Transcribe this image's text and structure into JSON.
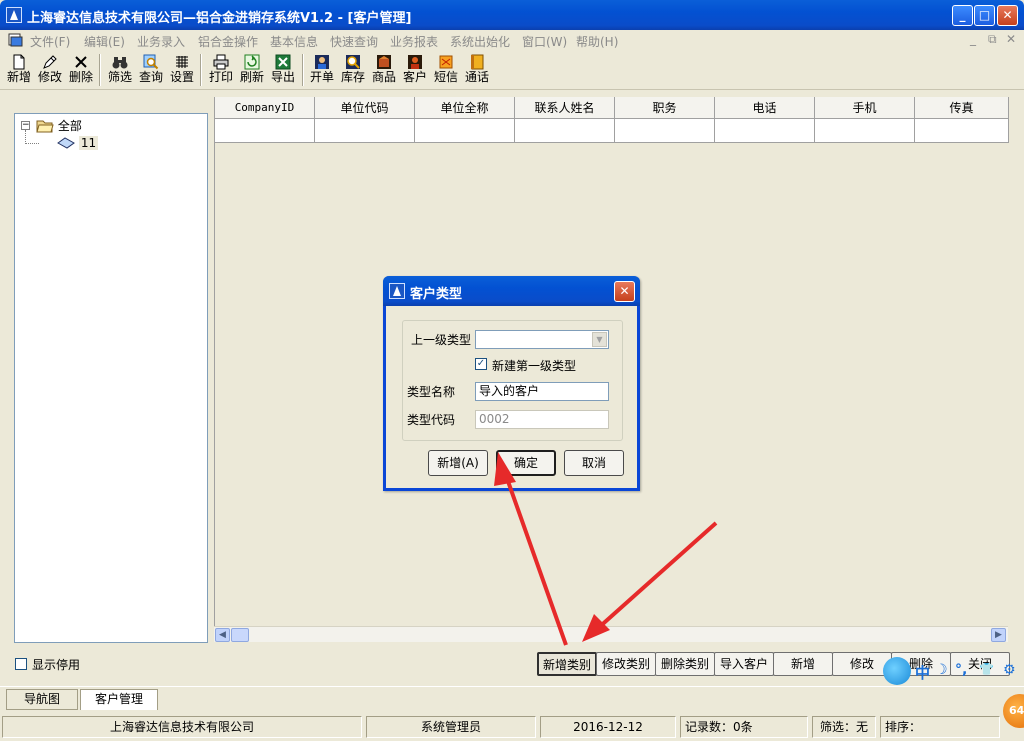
{
  "window": {
    "title": "上海睿达信息技术有限公司—铝合金进销存系统V1.2 - [客户管理]",
    "minimize": "_",
    "maximize": "□",
    "close": "✕"
  },
  "menu": {
    "items": [
      "文件(F)",
      "编辑(E)",
      "业务录入",
      "铝合金操作",
      "基本信息",
      "快速查询",
      "业务报表",
      "系统出始化",
      "窗口(W)",
      "帮助(H)"
    ],
    "mdi_minimize": "_",
    "mdi_restore": "⧉",
    "mdi_close": "✕"
  },
  "toolbar": {
    "items": [
      {
        "label": "新增",
        "icon": "new-doc-icon"
      },
      {
        "label": "修改",
        "icon": "edit-icon"
      },
      {
        "label": "删除",
        "icon": "delete-x-icon"
      },
      {
        "label": "筛选",
        "icon": "binoculars-icon"
      },
      {
        "label": "查询",
        "icon": "search-icon"
      },
      {
        "label": "设置",
        "icon": "settings-icon"
      },
      {
        "label": "打印",
        "icon": "printer-icon"
      },
      {
        "label": "刷新",
        "icon": "refresh-icon"
      },
      {
        "label": "导出",
        "icon": "excel-export-icon"
      },
      {
        "label": "开单",
        "icon": "order-icon"
      },
      {
        "label": "库存",
        "icon": "inventory-icon"
      },
      {
        "label": "商品",
        "icon": "product-icon"
      },
      {
        "label": "客户",
        "icon": "customer-icon"
      },
      {
        "label": "短信",
        "icon": "sms-icon"
      },
      {
        "label": "通话",
        "icon": "phone-book-icon"
      }
    ]
  },
  "tree": {
    "root_label": "全部",
    "toggle": "−",
    "children": [
      "11"
    ]
  },
  "grid": {
    "columns": [
      "CompanyID",
      "单位代码",
      "单位全称",
      "联系人姓名",
      "职务",
      "电话",
      "手机",
      "传真"
    ],
    "scroll_left": "◀",
    "scroll_right": "▶"
  },
  "bottom": {
    "show_disabled_label": "显示停用",
    "buttons": [
      "新增类别",
      "修改类别",
      "删除类别",
      "导入客户",
      "新增",
      "修改",
      "删除",
      "关闭"
    ]
  },
  "tabs": [
    "导航图",
    "客户管理"
  ],
  "status": {
    "company": "上海睿达信息技术有限公司",
    "user": "系统管理员",
    "date": "2016-12-12",
    "records": "记录数：0条",
    "filter": "筛选：无",
    "sort": "排序："
  },
  "dialog": {
    "title": "客户类型",
    "close": "✕",
    "parent_type_label": "上一级类型",
    "parent_type_value": "",
    "combo_arrow": "▼",
    "new_first_level_label": "新建第一级类型",
    "new_first_level_checked": "✓",
    "type_name_label": "类型名称",
    "type_name_value": "导入的客户",
    "type_code_label": "类型代码",
    "type_code_value": "0002",
    "btn_new": "新增(A)",
    "btn_ok": "确定",
    "btn_cancel": "取消"
  },
  "ime": {
    "lang": "中",
    "moon": "☽",
    "punct": "°,",
    "shirt": "👕",
    "gear": "⚙",
    "badge": "64"
  }
}
